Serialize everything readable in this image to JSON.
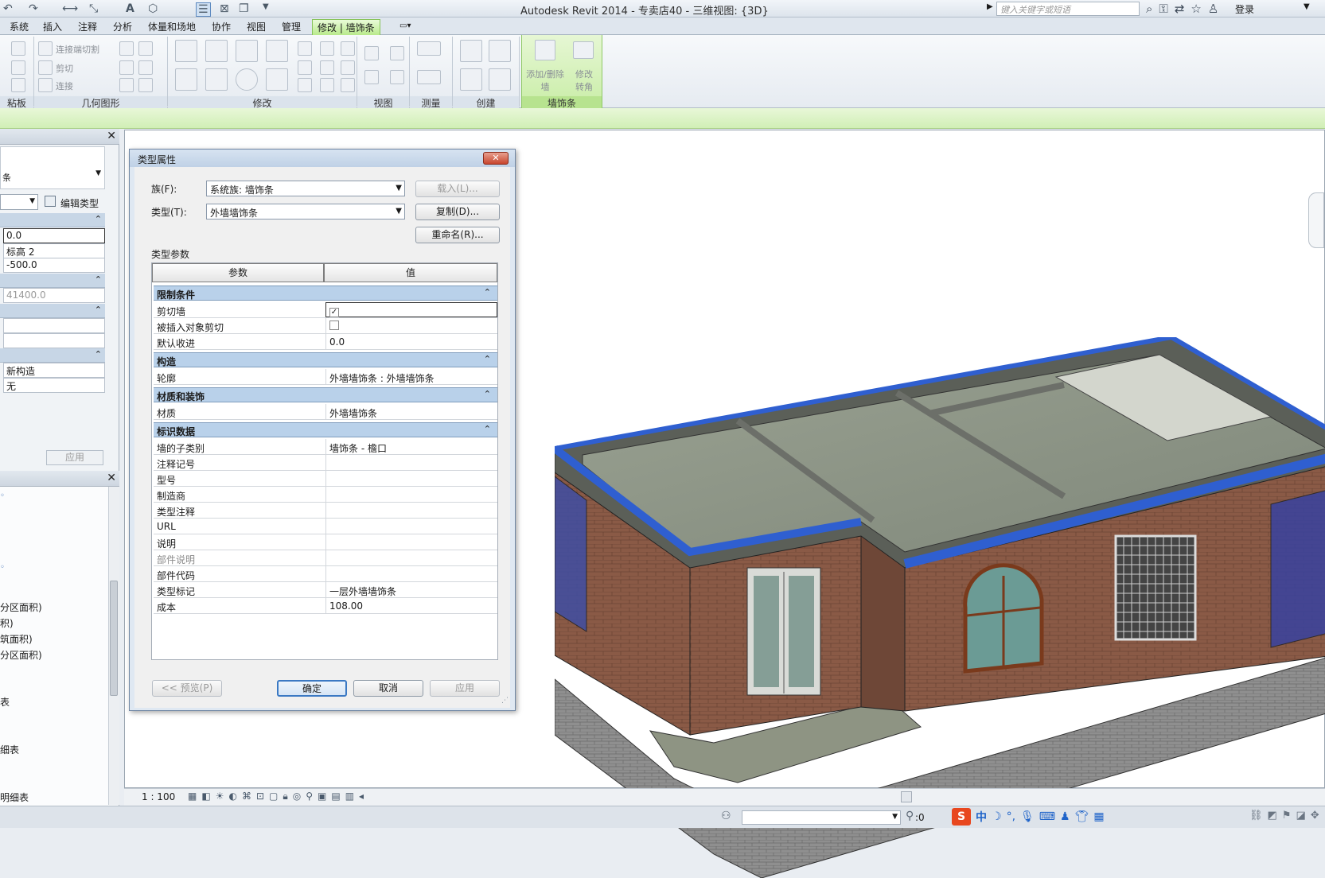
{
  "window": {
    "title": "Autodesk Revit 2014 -     专卖店40 - 三维视图: {3D}",
    "search_placeholder": "键入关键字或短语",
    "login": "登录"
  },
  "ribbon": {
    "tabs": [
      "系统",
      "插入",
      "注释",
      "分析",
      "体量和场地",
      "协作",
      "视图",
      "管理"
    ],
    "active_tab": "修改 | 墙饰条",
    "panels": [
      "粘板",
      "几何图形",
      "修改",
      "视图",
      "测量",
      "创建",
      "墙饰条"
    ],
    "geometry_buttons": [
      "连接端切割",
      "剪切",
      "连接"
    ],
    "context_buttons": [
      "添加/删除墙",
      "修改转角"
    ]
  },
  "properties": {
    "edit_type": "编辑类型",
    "fields": [
      "0.0",
      "标高 2",
      "-500.0",
      "41400.0",
      "新构造",
      "无"
    ],
    "apply": "应用"
  },
  "browser": {
    "items": [
      "分区面积)",
      "积)",
      "筑面积)",
      "分区面积)",
      "表",
      "细表",
      "明细表"
    ]
  },
  "dialog": {
    "title": "类型属性",
    "family_label": "族(F):",
    "family_value": "系统族: 墙饰条",
    "type_label": "类型(T):",
    "type_value": "外墙墙饰条",
    "load_button": "载入(L)...",
    "duplicate_button": "复制(D)...",
    "rename_button": "重命名(R)...",
    "type_params_label": "类型参数",
    "col_param": "参数",
    "col_value": "值",
    "groups": [
      {
        "name": "限制条件",
        "rows": [
          {
            "name": "剪切墙",
            "value": "",
            "check": true
          },
          {
            "name": "被插入对象剪切",
            "value": "",
            "check": false
          },
          {
            "name": "默认收进",
            "value": "0.0"
          }
        ]
      },
      {
        "name": "构造",
        "rows": [
          {
            "name": "轮廓",
            "value": "外墙墙饰条 : 外墙墙饰条"
          }
        ]
      },
      {
        "name": "材质和装饰",
        "rows": [
          {
            "name": "材质",
            "value": "外墙墙饰条"
          }
        ]
      },
      {
        "name": "标识数据",
        "rows": [
          {
            "name": "墙的子类别",
            "value": "墙饰条 - 檐口"
          },
          {
            "name": "注释记号",
            "value": ""
          },
          {
            "name": "型号",
            "value": ""
          },
          {
            "name": "制造商",
            "value": ""
          },
          {
            "name": "类型注释",
            "value": ""
          },
          {
            "name": "URL",
            "value": ""
          },
          {
            "name": "说明",
            "value": ""
          },
          {
            "name": "部件说明",
            "value": ""
          },
          {
            "name": "部件代码",
            "value": ""
          },
          {
            "name": "类型标记",
            "value": "一层外墙墙饰条"
          },
          {
            "name": "成本",
            "value": "108.00"
          }
        ]
      }
    ],
    "preview_button": "<< 预览(P)",
    "ok_button": "确定",
    "cancel_button": "取消",
    "apply_button": "应用"
  },
  "viewbar": {
    "scale": "1 : 100"
  },
  "status": {
    "zero": ":0",
    "ime_lang": "中"
  }
}
